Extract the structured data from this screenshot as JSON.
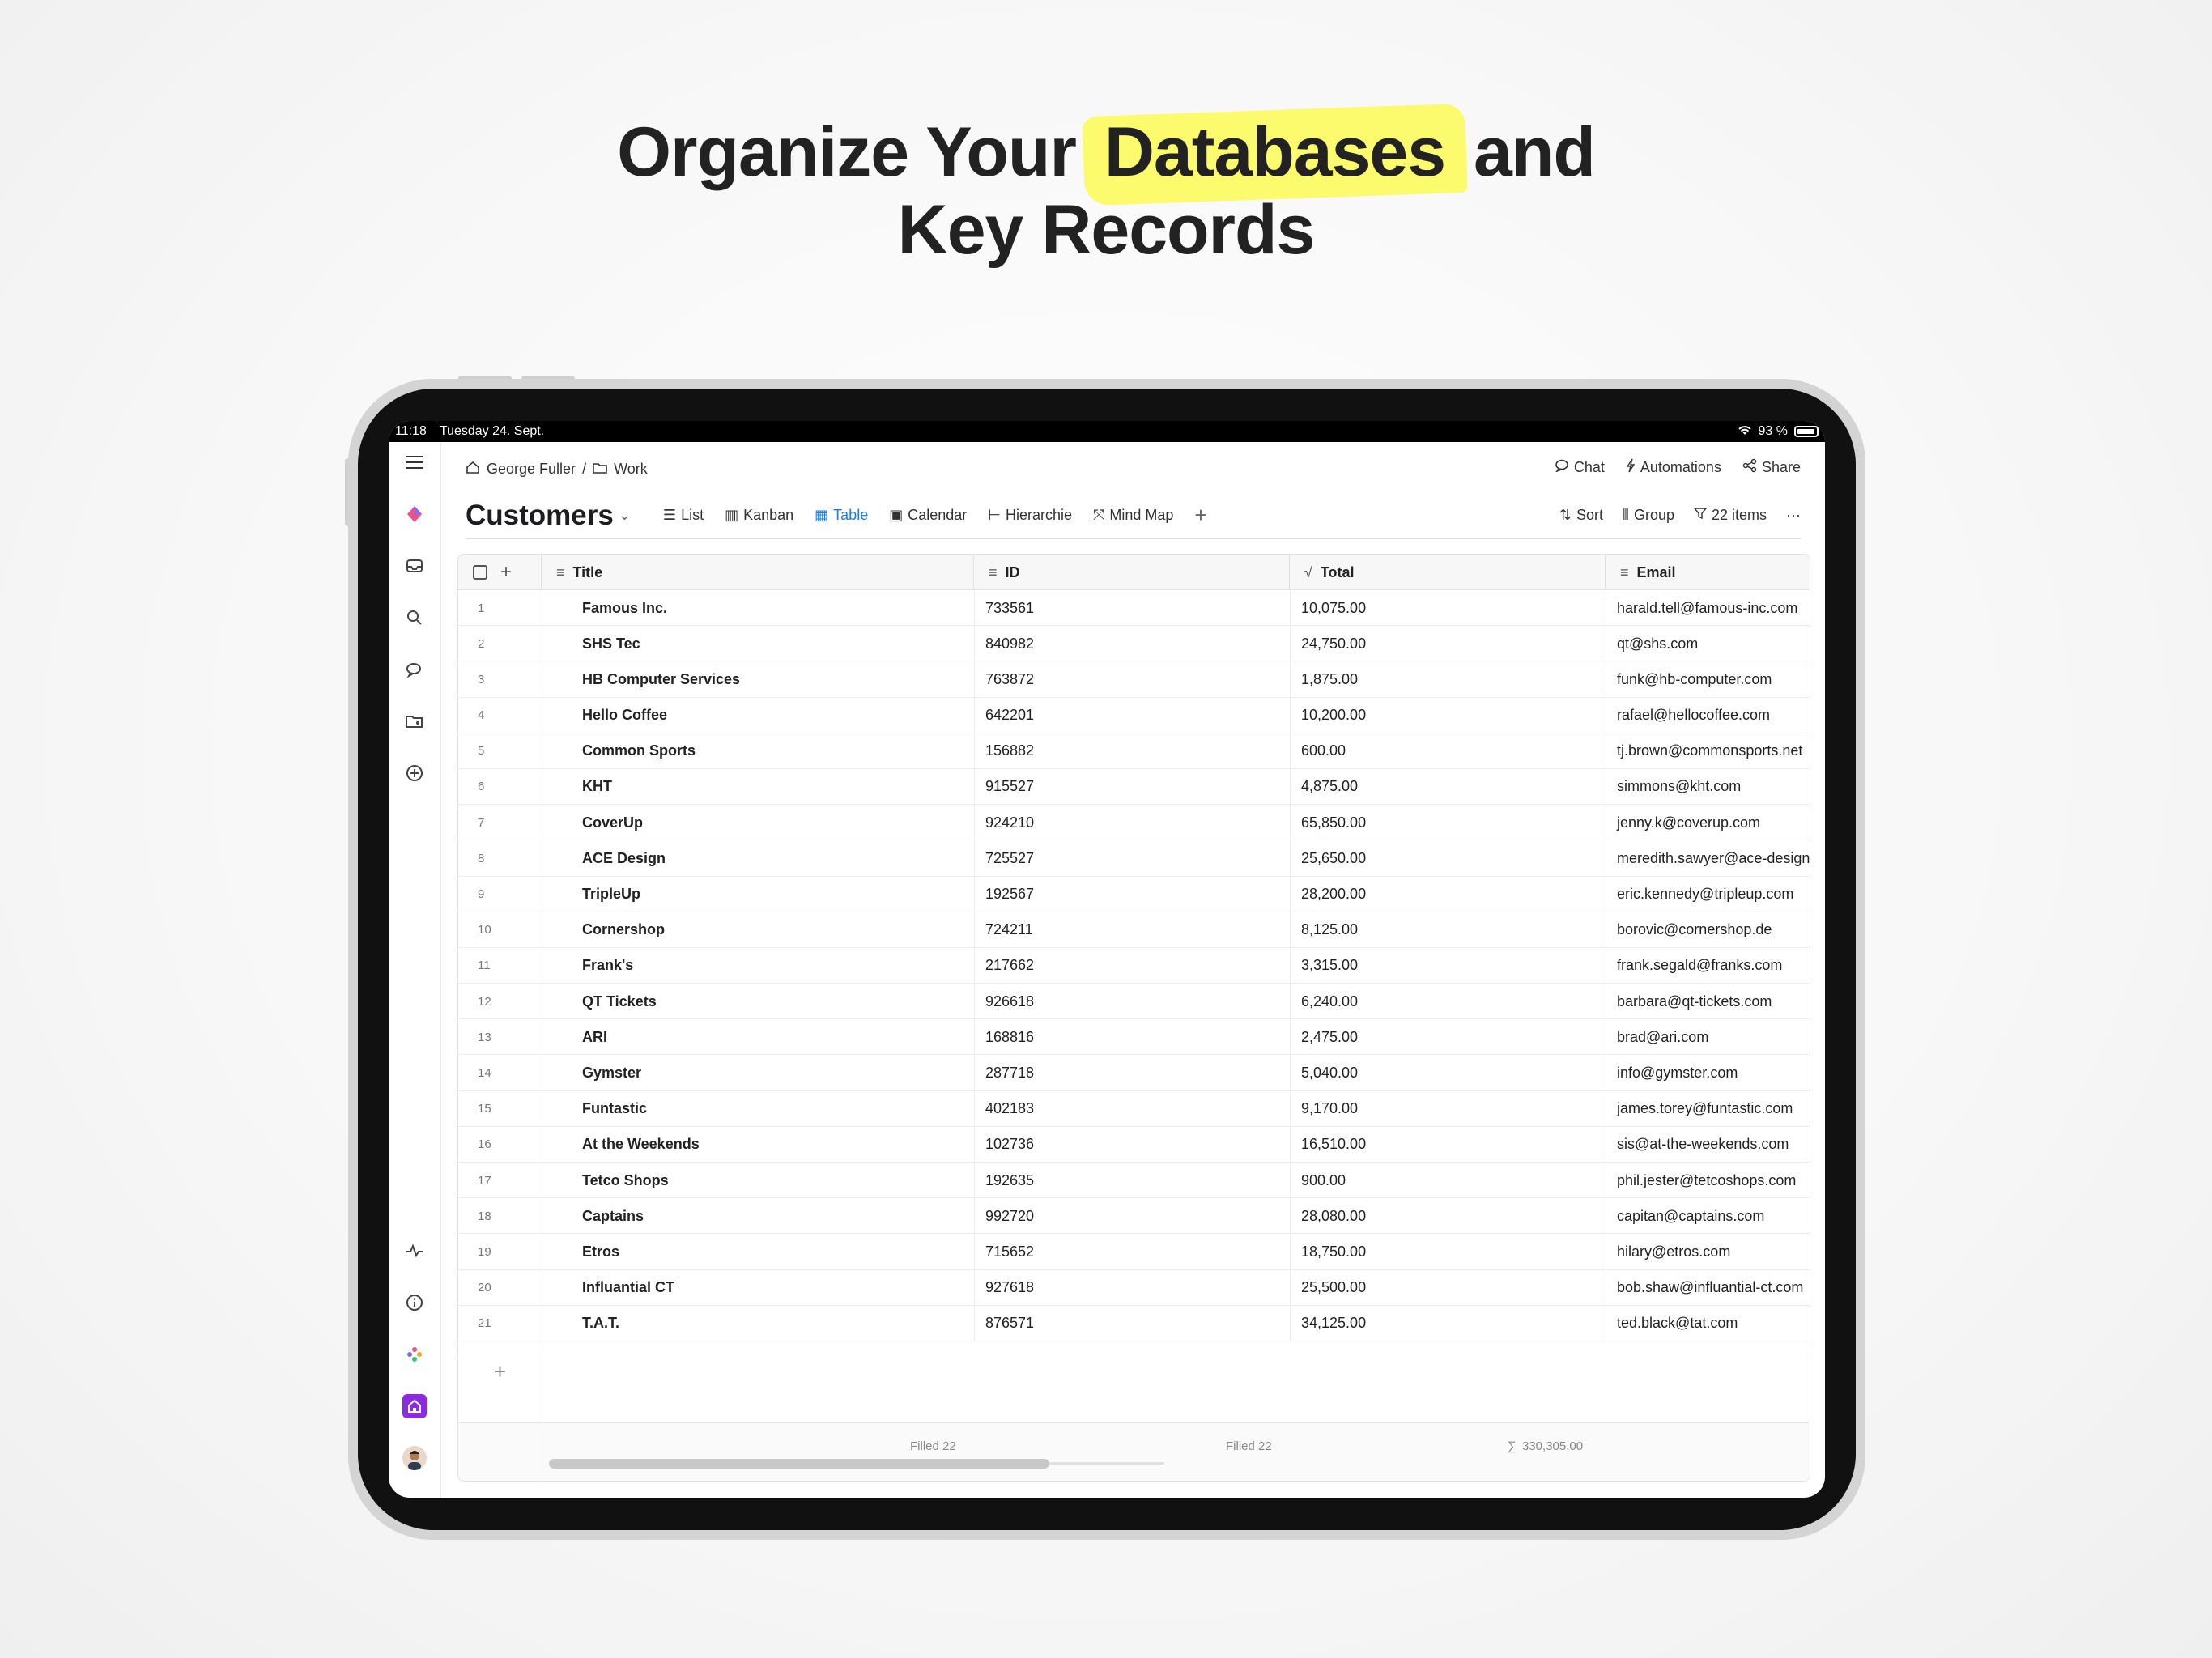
{
  "headline": {
    "line1_before": "Organize Your",
    "line1_highlight": "Databases",
    "line1_after": "and",
    "line2": "Key Records"
  },
  "status_bar": {
    "time": "11:18",
    "date": "Tuesday 24. Sept.",
    "battery": "93 %"
  },
  "breadcrumb": {
    "user": "George Fuller",
    "separator": "/",
    "folder": "Work"
  },
  "top_actions": {
    "chat": "Chat",
    "automations": "Automations",
    "share": "Share"
  },
  "page": {
    "title": "Customers"
  },
  "views": {
    "list": "List",
    "kanban": "Kanban",
    "table": "Table",
    "calendar": "Calendar",
    "hierarchie": "Hierarchie",
    "mindmap": "Mind Map"
  },
  "tools": {
    "sort": "Sort",
    "group": "Group",
    "items": "22 items"
  },
  "columns": {
    "title": "Title",
    "id": "ID",
    "total": "Total",
    "email": "Email"
  },
  "rows": [
    {
      "n": "1",
      "title": "Famous Inc.",
      "id": "733561",
      "total": "10,075.00",
      "email": "harald.tell@famous-inc.com"
    },
    {
      "n": "2",
      "title": "SHS Tec",
      "id": "840982",
      "total": "24,750.00",
      "email": "qt@shs.com"
    },
    {
      "n": "3",
      "title": "HB Computer Services",
      "id": "763872",
      "total": "1,875.00",
      "email": "funk@hb-computer.com"
    },
    {
      "n": "4",
      "title": "Hello Coffee",
      "id": "642201",
      "total": "10,200.00",
      "email": "rafael@hellocoffee.com"
    },
    {
      "n": "5",
      "title": "Common Sports",
      "id": "156882",
      "total": "600.00",
      "email": "tj.brown@commonsports.net"
    },
    {
      "n": "6",
      "title": "KHT",
      "id": "915527",
      "total": "4,875.00",
      "email": "simmons@kht.com"
    },
    {
      "n": "7",
      "title": "CoverUp",
      "id": "924210",
      "total": "65,850.00",
      "email": "jenny.k@coverup.com"
    },
    {
      "n": "8",
      "title": "ACE Design",
      "id": "725527",
      "total": "25,650.00",
      "email": "meredith.sawyer@ace-design.com"
    },
    {
      "n": "9",
      "title": "TripleUp",
      "id": "192567",
      "total": "28,200.00",
      "email": "eric.kennedy@tripleup.com"
    },
    {
      "n": "10",
      "title": "Cornershop",
      "id": "724211",
      "total": "8,125.00",
      "email": "borovic@cornershop.de"
    },
    {
      "n": "11",
      "title": "Frank's",
      "id": "217662",
      "total": "3,315.00",
      "email": "frank.segald@franks.com"
    },
    {
      "n": "12",
      "title": "QT Tickets",
      "id": "926618",
      "total": "6,240.00",
      "email": "barbara@qt-tickets.com"
    },
    {
      "n": "13",
      "title": "ARI",
      "id": "168816",
      "total": "2,475.00",
      "email": "brad@ari.com"
    },
    {
      "n": "14",
      "title": "Gymster",
      "id": "287718",
      "total": "5,040.00",
      "email": "info@gymster.com"
    },
    {
      "n": "15",
      "title": "Funtastic",
      "id": "402183",
      "total": "9,170.00",
      "email": "james.torey@funtastic.com"
    },
    {
      "n": "16",
      "title": "At the Weekends",
      "id": "102736",
      "total": "16,510.00",
      "email": "sis@at-the-weekends.com"
    },
    {
      "n": "17",
      "title": "Tetco Shops",
      "id": "192635",
      "total": "900.00",
      "email": "phil.jester@tetcoshops.com"
    },
    {
      "n": "18",
      "title": "Captains",
      "id": "992720",
      "total": "28,080.00",
      "email": "capitan@captains.com"
    },
    {
      "n": "19",
      "title": "Etros",
      "id": "715652",
      "total": "18,750.00",
      "email": "hilary@etros.com"
    },
    {
      "n": "20",
      "title": "Influantial CT",
      "id": "927618",
      "total": "25,500.00",
      "email": "bob.shaw@influantial-ct.com"
    },
    {
      "n": "21",
      "title": "T.A.T.",
      "id": "876571",
      "total": "34,125.00",
      "email": "ted.black@tat.com"
    }
  ],
  "footer": {
    "id_filled": "Filled 22",
    "total_filled": "Filled 22",
    "sum": "330,305.00"
  },
  "colors": {
    "accent": "#1b7cf4",
    "highlight": "#fbfb6d",
    "home_button": "#8a2be2"
  }
}
